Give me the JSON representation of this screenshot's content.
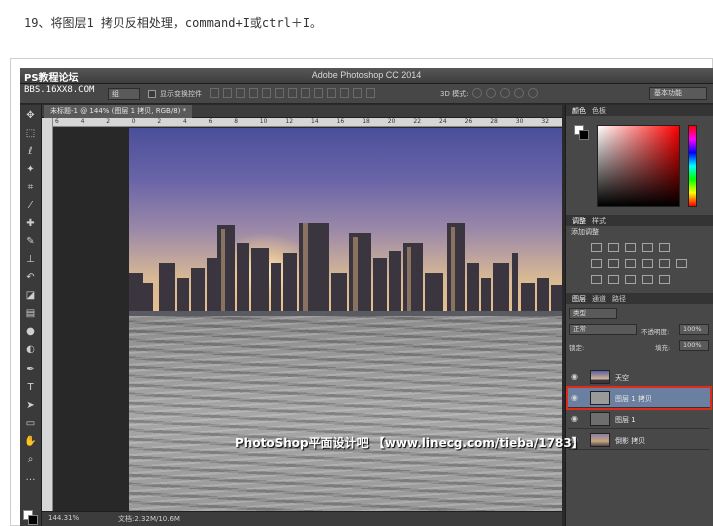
{
  "instruction": "19、将图层1 拷贝反相处理，command+I或ctrl＋I。",
  "watermark_top": "PS教程论坛",
  "watermark_top_url": "BBS.16XX8.COM",
  "app": {
    "title": "Adobe Photoshop CC 2014"
  },
  "options": {
    "selector": "组",
    "checkbox_label": "显示变换控件",
    "mode3d": "3D 模式:",
    "workspace": "基本功能"
  },
  "document": {
    "tab_title": "未标题-1 @ 144% (图层 1 拷贝, RGB/8) *",
    "ruler_ticks": [
      "6",
      "4",
      "2",
      "0",
      "2",
      "4",
      "6",
      "8",
      "10",
      "12",
      "14",
      "16",
      "18",
      "20",
      "22",
      "24",
      "26",
      "28",
      "30",
      "32"
    ]
  },
  "status": {
    "zoom": "144.31%",
    "doc_size": "文档:2.32M/10.6M"
  },
  "bottom_watermark": "PhotoShop平面设计吧  【www.linecg.com/tieba/1783】",
  "color_panel": {
    "tabs": [
      "颜色",
      "色板"
    ]
  },
  "adjust_panel": {
    "tabs": [
      "调整",
      "样式"
    ],
    "title": "添加调整"
  },
  "layers_panel": {
    "tabs": [
      "图层",
      "通道",
      "路径"
    ],
    "filter": "类型",
    "blend_mode": "正常",
    "opacity_label": "不透明度:",
    "opacity": "100%",
    "lock_label": "锁定:",
    "fill_label": "填充:",
    "fill": "100%",
    "layers": [
      {
        "name": "天空",
        "selected": false
      },
      {
        "name": "图层 1 拷贝",
        "selected": true
      },
      {
        "name": "图层 1",
        "selected": false
      },
      {
        "name": "倒影 拷贝",
        "selected": false
      }
    ]
  },
  "colors": {
    "selection_outline": "#e02a1a",
    "selected_layer": "#6b7fa0"
  }
}
